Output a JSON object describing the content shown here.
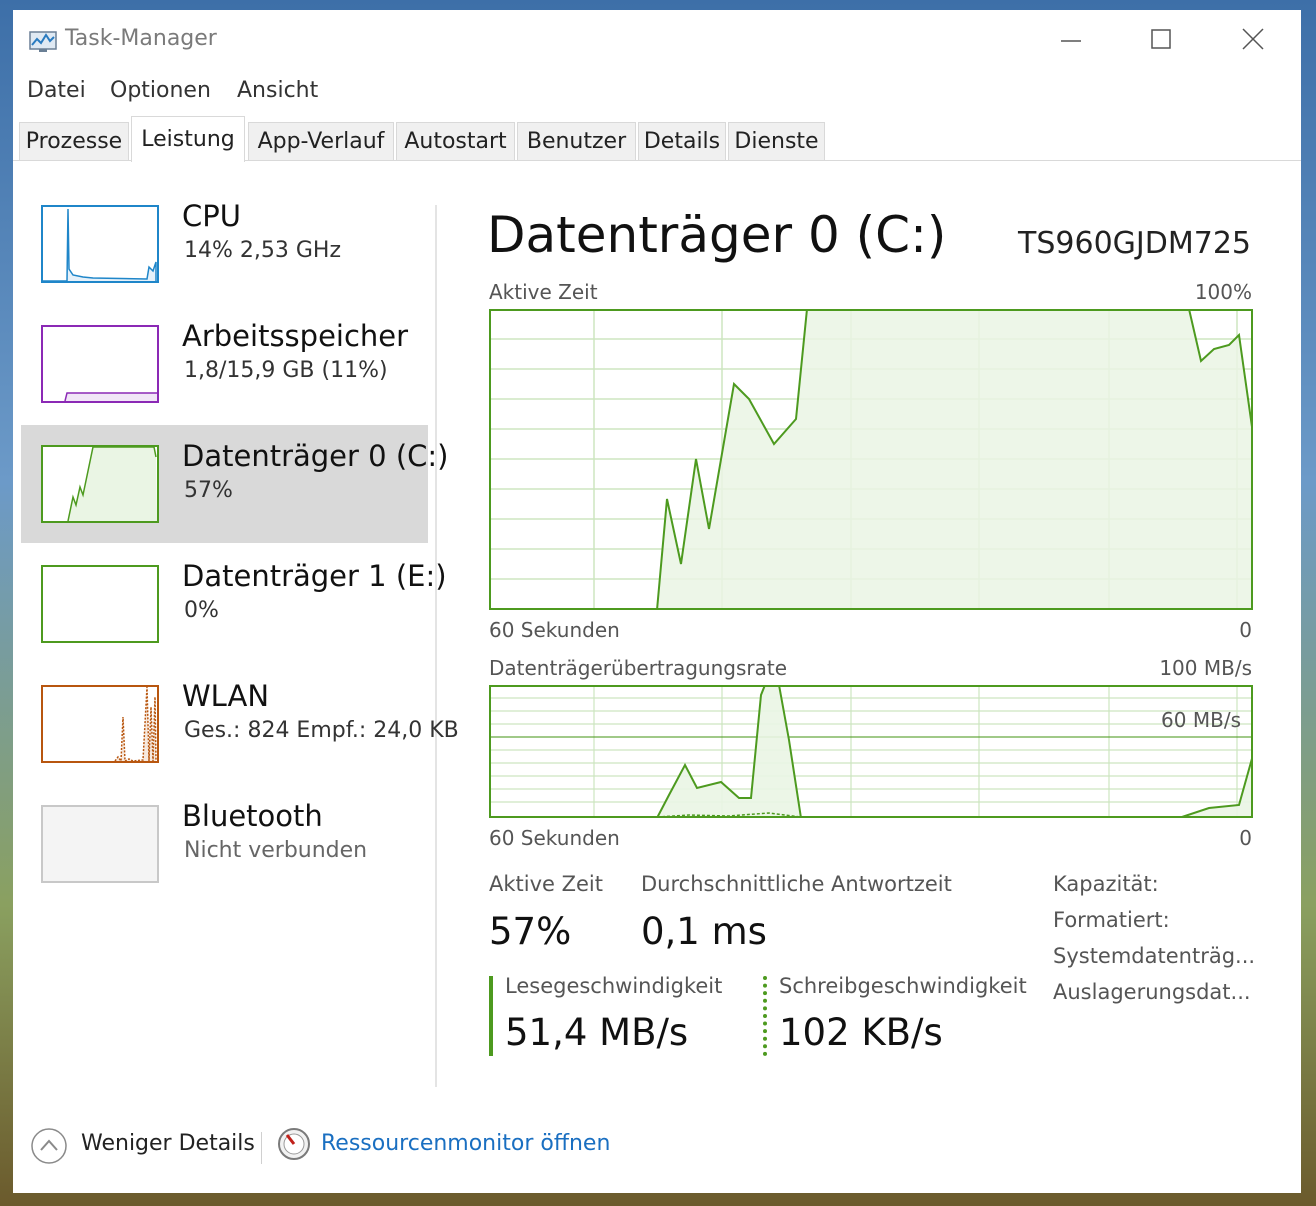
{
  "window": {
    "title": "Task-Manager"
  },
  "icons": {
    "app": "task-manager-icon",
    "minimize": "minimize-icon",
    "maximize": "maximize-icon",
    "close": "close-icon",
    "collapse": "chevron-up-circle-icon",
    "resmon": "resource-monitor-icon"
  },
  "menu": {
    "items": [
      "Datei",
      "Optionen",
      "Ansicht"
    ]
  },
  "tabs": [
    "Prozesse",
    "Leistung",
    "App-Verlauf",
    "Autostart",
    "Benutzer",
    "Details",
    "Dienste"
  ],
  "active_tab": "Leistung",
  "sidebar": {
    "items": [
      {
        "title": "CPU",
        "subtitle": "14%  2,53 GHz",
        "color": "#1f86c9"
      },
      {
        "title": "Arbeitsspeicher",
        "subtitle": "1,8/15,9 GB (11%)",
        "color": "#8b29b5"
      },
      {
        "title": "Datenträger 0 (C:)",
        "subtitle": "57%",
        "color": "#4d9a1f",
        "selected": true
      },
      {
        "title": "Datenträger 1 (E:)",
        "subtitle": "0%",
        "color": "#4d9a1f"
      },
      {
        "title": "WLAN",
        "subtitle": "Ges.: 824  Empf.: 24,0 KB",
        "color": "#b8560f"
      },
      {
        "title": "Bluetooth",
        "subtitle": "Nicht verbunden",
        "color": "#b0b0b0"
      }
    ]
  },
  "detail": {
    "title": "Datenträger 0 (C:)",
    "model": "TS960GJDM725",
    "graph1": {
      "label": "Aktive Zeit",
      "max_label": "100%",
      "x_left": "60 Sekunden",
      "x_right": "0"
    },
    "graph2": {
      "label": "Datenträgerübertragungsrate",
      "max_label": "100 MB/s",
      "ref_label": "60 MB/s",
      "x_left": "60 Sekunden",
      "x_right": "0"
    },
    "stats": {
      "active_time": {
        "label": "Aktive Zeit",
        "value": "57%"
      },
      "response": {
        "label": "Durchschnittliche Antwortzeit",
        "value": "0,1 ms"
      },
      "read": {
        "label": "Lesegeschwindigkeit",
        "value": "51,4 MB/s"
      },
      "write": {
        "label": "Schreibgeschwindigkeit",
        "value": "102 KB/s"
      }
    },
    "properties": [
      "Kapazität:",
      "Formatiert:",
      "Systemdatenträg...",
      "Auslagerungsdat..."
    ]
  },
  "footer": {
    "less_details": "Weniger Details",
    "resmon_link": "Ressourcenmonitor öffnen"
  },
  "colors": {
    "disk_line": "#4d9a1f",
    "disk_fill": "#eaf5e4",
    "disk_grid": "#cde5c0",
    "link": "#1a6fc1",
    "selected_bg": "#d9d9d9"
  }
}
